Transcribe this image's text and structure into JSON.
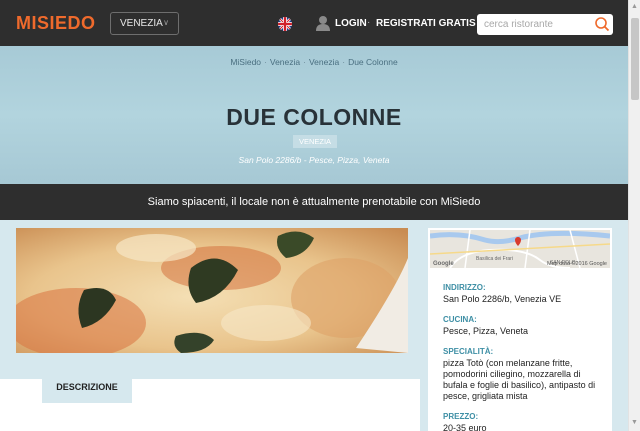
{
  "header": {
    "logo_text": "MISIEDO",
    "city_selector": "VENEZIA",
    "login_label": "LOGIN",
    "separator": "·",
    "register_label": "REGISTRATI GRATIS",
    "search_placeholder": "cerca ristorante",
    "brand_color": "#ef6a2c"
  },
  "breadcrumb": [
    "MiSiedo",
    "Venezia",
    "Venezia",
    "Due Colonne"
  ],
  "restaurant": {
    "name": "DUE COLONNE",
    "city_badge": "VENEZIA",
    "subtitle": "San Polo 2286/b - Pesce, Pizza, Veneta"
  },
  "notice": "Siamo spiacenti, il locale non è attualmente prenotabile con MiSiedo",
  "map": {
    "brand": "Google",
    "label_1": "Basilica dei Frari",
    "label_2": "SAN POLO",
    "credit": "Map data ©2016 Google"
  },
  "info": {
    "address_label": "INDIRIZZO:",
    "address_value": "San Polo 2286/b, Venezia VE",
    "cuisine_label": "CUCINA:",
    "cuisine_value": "Pesce, Pizza, Veneta",
    "specialty_label": "SPECIALITÀ:",
    "specialty_value": "pizza Totò (con melanzane fritte, pomodorini ciliegino, mozzarella di bufala e foglie di basilico), antipasto di pesce, grigliata mista",
    "price_label": "PREZZO:",
    "price_value": "20-35 euro"
  },
  "tabs": {
    "description": "DESCRIZIONE"
  }
}
